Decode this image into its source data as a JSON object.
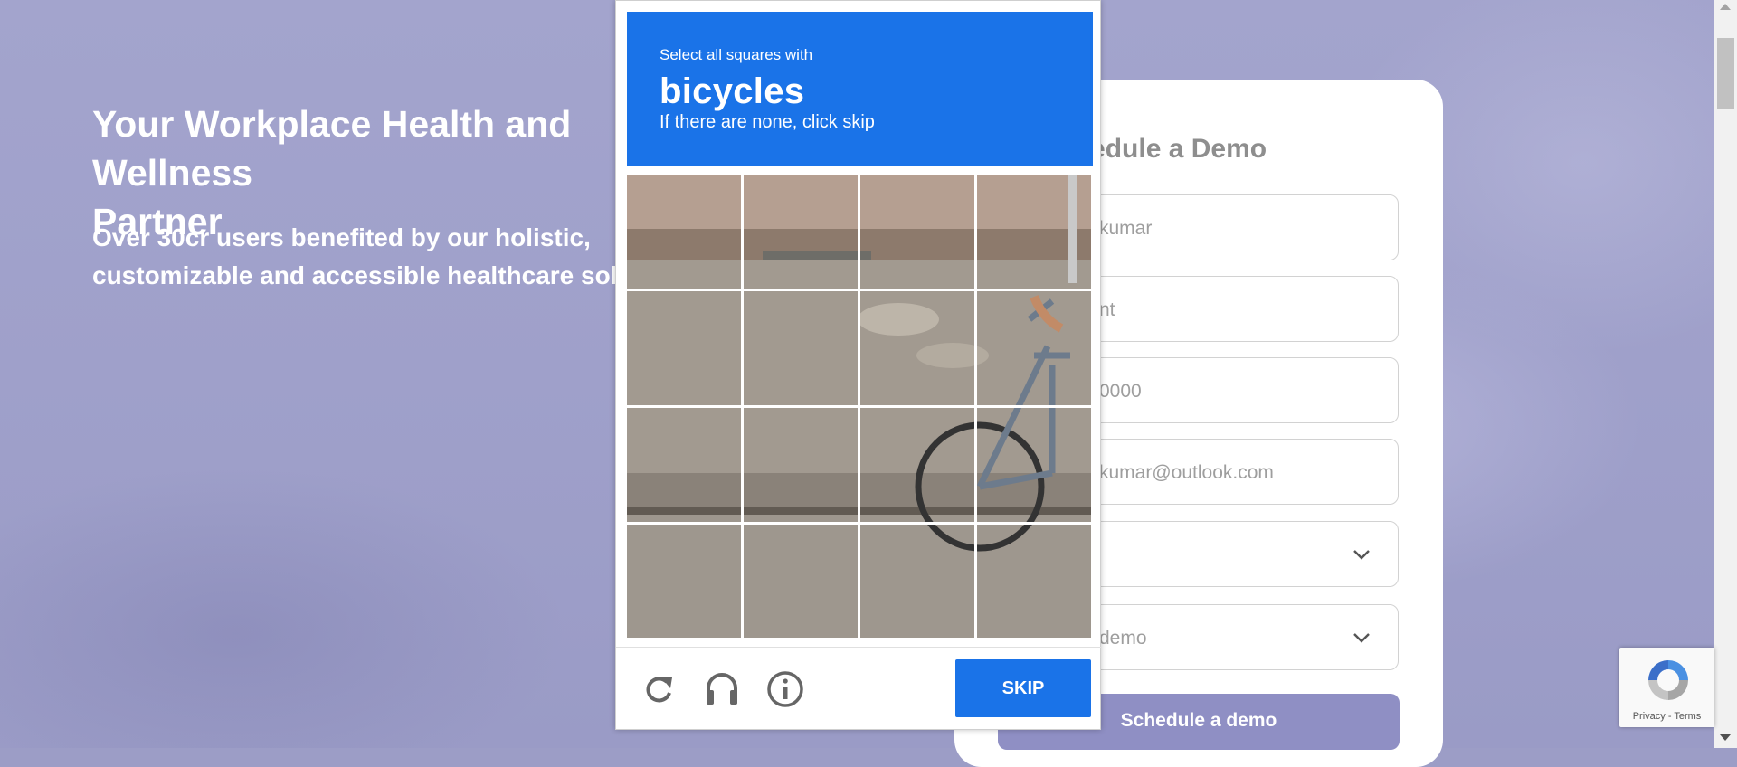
{
  "hero": {
    "title": "Your Workplace Health and Wellness\nPartner",
    "subtitle": "Over 30cr users benefited by our holistic,\ncustomizable and accessible healthcare solutions"
  },
  "demo_form": {
    "title": "Schedule a Demo",
    "fields": [
      {
        "value": "kumar"
      },
      {
        "value": "nt"
      },
      {
        "value": "0000"
      },
      {
        "value": "kumar@outlook.com"
      },
      {
        "value": ""
      },
      {
        "value": "demo"
      }
    ],
    "submit_label": "Schedule a demo"
  },
  "captcha": {
    "instruction": "Select all squares with",
    "target": "bicycles",
    "hint": "If there are none, click skip",
    "skip_label": "SKIP",
    "icons": [
      "reload-icon",
      "audio-headphones-icon",
      "info-icon"
    ],
    "grid": {
      "rows": 4,
      "cols": 4
    },
    "colors": {
      "header": "#1a73e8",
      "button": "#1a73e8"
    }
  },
  "recaptcha_badge": {
    "text": "Privacy - Terms"
  },
  "colors": {
    "background": "#9c9dc6",
    "cta": "#8f8fc4"
  }
}
